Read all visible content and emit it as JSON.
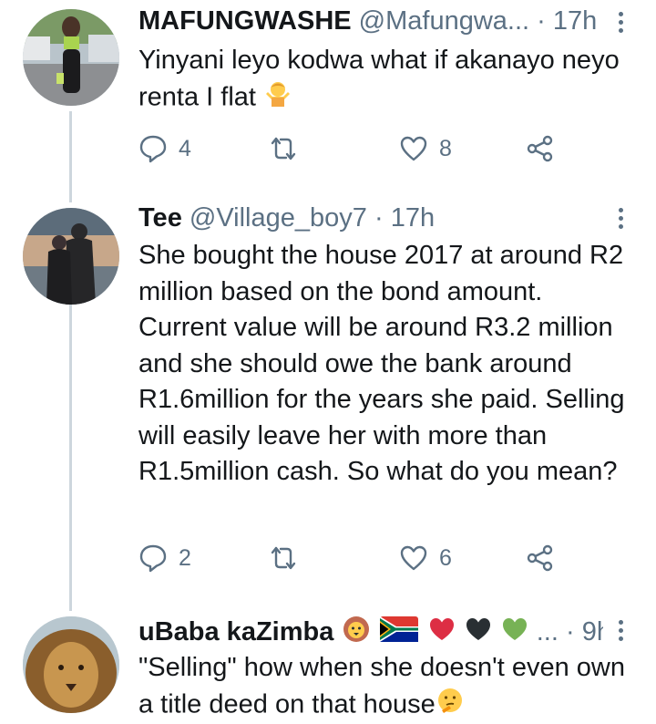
{
  "tweets": [
    {
      "name": "MAFUNGWASHE",
      "handle": "@Mafungwa...",
      "dot": "·",
      "time": "17h",
      "text": "Yinyani leyo kodwa what if akanayo neyo renta I flat",
      "text_emoji": "person-shrugging-emoji",
      "replies": "4",
      "retweets": "",
      "likes": "8"
    },
    {
      "name": "Tee",
      "handle": "@Village_boy7",
      "dot": "·",
      "time": "17h",
      "text": "She bought the house 2017 at around R2 million based on the bond amount. Current value will be around R3.2 million and she should owe the bank around R1.6million for the years she paid. Selling will easily leave her with more than R1.5million cash. So what do you mean?",
      "replies": "2",
      "retweets": "",
      "likes": "6"
    },
    {
      "name": "uBaba kaZimba",
      "name_emojis": [
        "lion-face-emoji",
        "south-africa-flag-emoji",
        "red-heart-emoji",
        "black-heart-emoji",
        "green-heart-emoji"
      ],
      "ellipsis": "...",
      "dot": "·",
      "time": "9h",
      "text": "\"Selling\" how when she doesn't even own a title deed on that house",
      "text_emoji": "thinking-face-emoji"
    }
  ],
  "colors": {
    "text": "#14171a",
    "muted": "#5b7083",
    "thread_line": "#cdd6dd"
  }
}
